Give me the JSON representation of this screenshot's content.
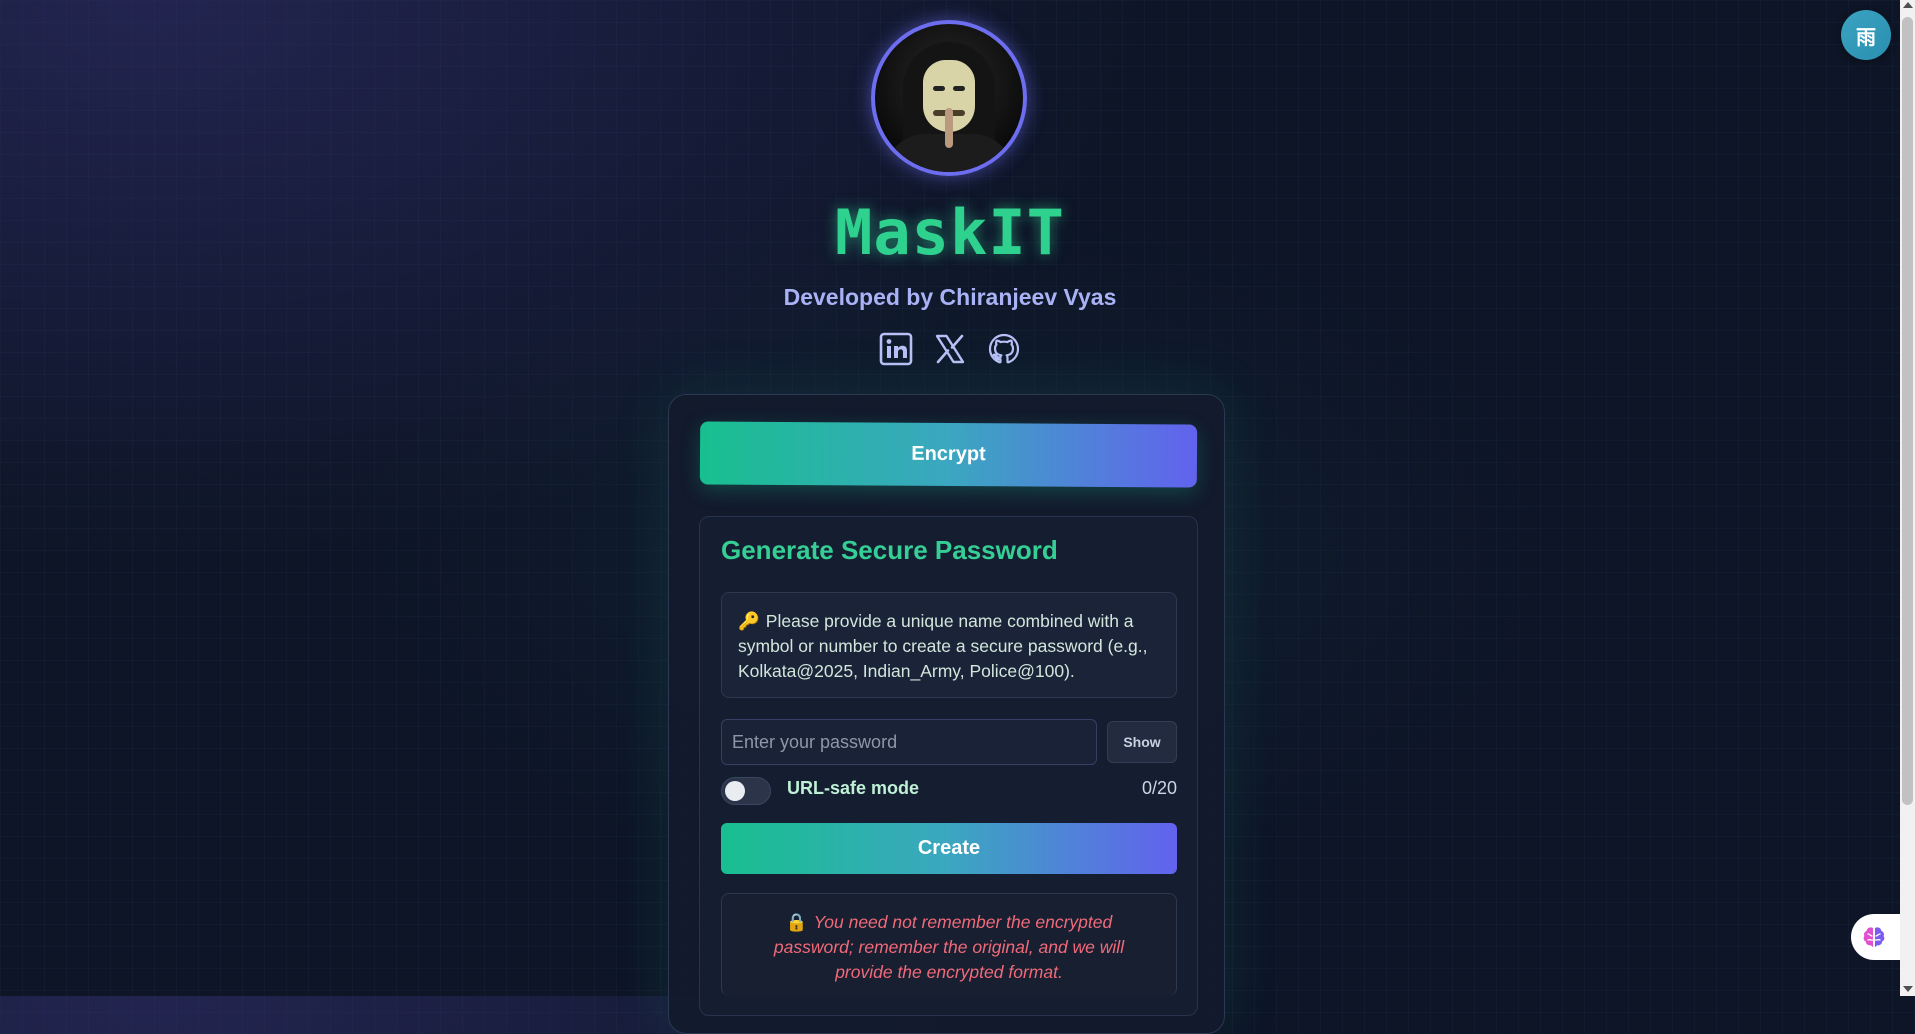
{
  "app": {
    "title": "MaskIT",
    "subtitle": "Developed by Chiranjeev Vyas"
  },
  "socials": [
    {
      "name": "linkedin",
      "icon": "linkedin-icon"
    },
    {
      "name": "x",
      "icon": "x-icon"
    },
    {
      "name": "github",
      "icon": "github-icon"
    }
  ],
  "encrypt_button": "Encrypt",
  "generator": {
    "heading": "Generate Secure Password",
    "info_icon": "key-icon",
    "info_text": "Please provide a unique name combined with a symbol or number to create a secure password (e.g., Kolkata@2025, Indian_Army, Police@100).",
    "password_placeholder": "Enter your password",
    "password_value": "",
    "show_label": "Show",
    "url_safe_label": "URL-safe mode",
    "url_safe_enabled": false,
    "counter": "0/20",
    "create_label": "Create",
    "warning_icon": "lock-icon",
    "warning_text": "You need not remember the encrypted password; remember the original, and we will provide the encrypted format."
  },
  "floating": {
    "translate_label": "雨"
  },
  "colors": {
    "accent_green": "#2fd18f",
    "accent_purple": "#6262ee",
    "subtitle": "#a9b2f5",
    "warning": "#f06a79",
    "background": "#0d1526"
  }
}
